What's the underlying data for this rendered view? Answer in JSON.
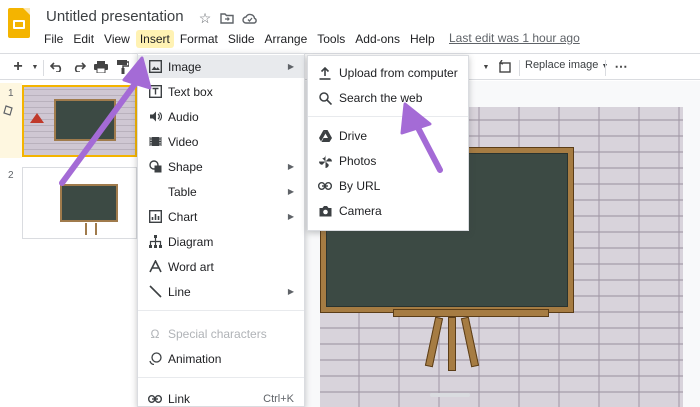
{
  "document": {
    "title": "Untitled presentation",
    "last_edit": "Last edit was 1 hour ago"
  },
  "title_icons": [
    "star-icon",
    "move-to-folder-icon",
    "cloud-status-icon"
  ],
  "menubar": {
    "items": [
      {
        "label": "File",
        "active": false
      },
      {
        "label": "Edit",
        "active": false
      },
      {
        "label": "View",
        "active": false
      },
      {
        "label": "Insert",
        "active": true
      },
      {
        "label": "Format",
        "active": false
      },
      {
        "label": "Slide",
        "active": false
      },
      {
        "label": "Arrange",
        "active": false
      },
      {
        "label": "Tools",
        "active": false
      },
      {
        "label": "Add-ons",
        "active": false
      },
      {
        "label": "Help",
        "active": false
      }
    ]
  },
  "toolbar": {
    "new_slide_icon": "plus-icon",
    "replace_image_label": "Replace image",
    "more_icon": "more-options-icon"
  },
  "filmstrip": {
    "slides": [
      {
        "number": "1",
        "selected": true
      },
      {
        "number": "2",
        "selected": false
      }
    ]
  },
  "insert_menu": {
    "items": [
      {
        "label": "Image",
        "icon": "image-icon",
        "submenu": true,
        "shortcut": "",
        "disabled": false,
        "highlighted": true
      },
      {
        "label": "Text box",
        "icon": "text-box-icon",
        "submenu": false,
        "shortcut": "",
        "disabled": false
      },
      {
        "label": "Audio",
        "icon": "audio-icon",
        "submenu": false,
        "shortcut": "",
        "disabled": false
      },
      {
        "label": "Video",
        "icon": "video-icon",
        "submenu": false,
        "shortcut": "",
        "disabled": false
      },
      {
        "label": "Shape",
        "icon": "shape-icon",
        "submenu": true,
        "shortcut": "",
        "disabled": false
      },
      {
        "label": "Table",
        "icon": "",
        "submenu": true,
        "shortcut": "",
        "disabled": false
      },
      {
        "label": "Chart",
        "icon": "chart-icon",
        "submenu": true,
        "shortcut": "",
        "disabled": false
      },
      {
        "label": "Diagram",
        "icon": "diagram-icon",
        "submenu": false,
        "shortcut": "",
        "disabled": false
      },
      {
        "label": "Word art",
        "icon": "word-art-icon",
        "submenu": false,
        "shortcut": "",
        "disabled": false
      },
      {
        "label": "Line",
        "icon": "line-icon",
        "submenu": true,
        "shortcut": "",
        "disabled": false
      },
      {
        "label": "Special characters",
        "icon": "omega-icon",
        "submenu": false,
        "shortcut": "",
        "disabled": true
      },
      {
        "label": "Animation",
        "icon": "animation-icon",
        "submenu": false,
        "shortcut": "",
        "disabled": false
      },
      {
        "label": "Link",
        "icon": "link-icon",
        "submenu": false,
        "shortcut": "Ctrl+K",
        "disabled": false
      }
    ]
  },
  "image_menu": {
    "items": [
      {
        "label": "Upload from computer",
        "icon": "upload-icon"
      },
      {
        "label": "Search the web",
        "icon": "search-icon"
      },
      {
        "label": "Drive",
        "icon": "drive-icon"
      },
      {
        "label": "Photos",
        "icon": "photos-icon"
      },
      {
        "label": "By URL",
        "icon": "link-icon"
      },
      {
        "label": "Camera",
        "icon": "camera-icon"
      }
    ]
  },
  "colors": {
    "menu_active_bg": "#fff2b3",
    "slide_selected_border": "#f4b400",
    "annotation_arrow": "#a46bd6",
    "chalkboard": "#3c4a44",
    "board_frame": "#a67c43"
  }
}
